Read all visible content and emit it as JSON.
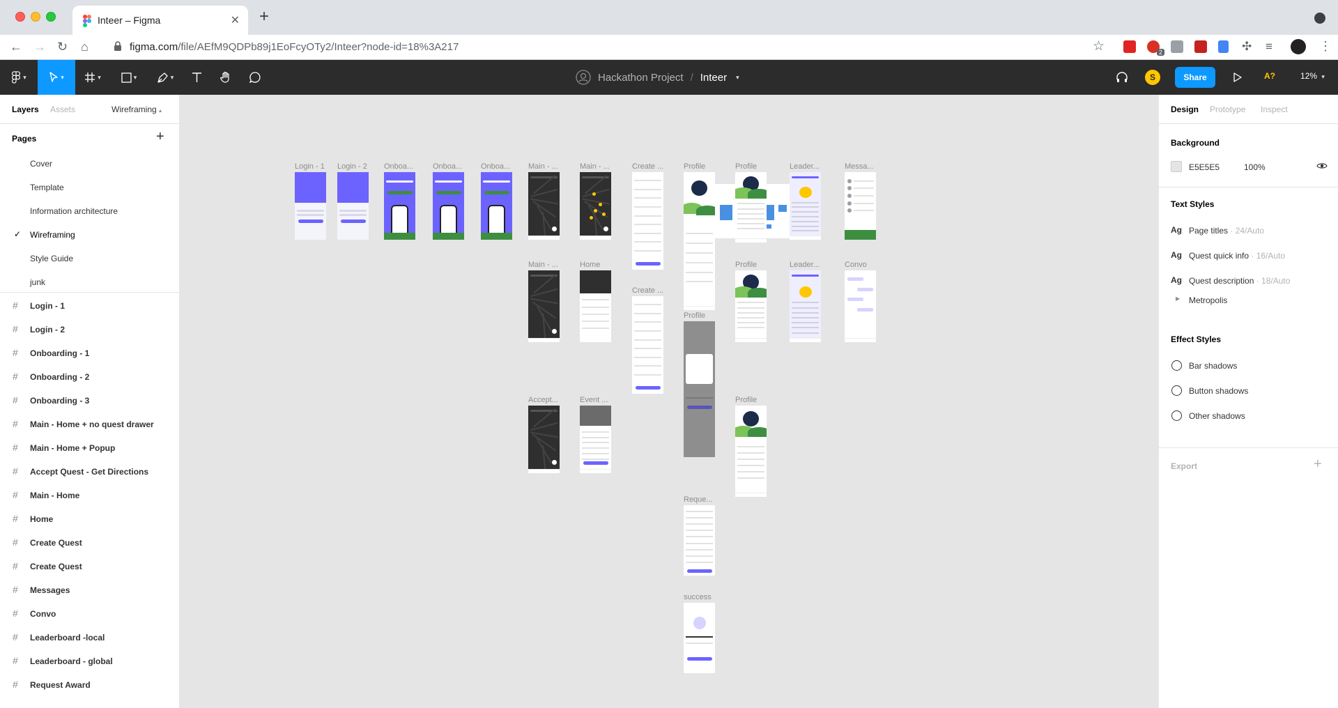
{
  "browser": {
    "tab_title": "Inteer – Figma",
    "url_host": "figma.com",
    "url_path": "/file/AEfM9QDPb89j1EoFcyOTy2/Inteer?node-id=18%3A217",
    "extension_badge": "2"
  },
  "toolbar": {
    "project": "Hackathon Project",
    "separator": "/",
    "file": "Inteer",
    "user_initial": "S",
    "share_label": "Share",
    "a_badge": "A?",
    "zoom": "12%"
  },
  "left_panel": {
    "tabs": {
      "layers": "Layers",
      "assets": "Assets",
      "current_page": "Wireframing"
    },
    "pages_title": "Pages",
    "pages": [
      {
        "label": "Cover"
      },
      {
        "label": "Template"
      },
      {
        "label": "Information architecture"
      },
      {
        "label": "Wireframing",
        "active": true
      },
      {
        "label": "Style Guide"
      },
      {
        "label": "junk"
      }
    ],
    "layers": [
      "Login - 1",
      "Login - 2",
      "Onboarding - 1",
      "Onboarding - 2",
      "Onboarding - 3",
      "Main - Home + no quest drawer",
      "Main - Home + Popup",
      "Accept Quest - Get Directions",
      "Main - Home",
      "Home",
      "Create Quest",
      "Create Quest",
      "Messages",
      "Convo",
      "Leaderboard -local",
      "Leaderboard - global",
      "Request Award"
    ]
  },
  "right_panel": {
    "tabs": {
      "design": "Design",
      "prototype": "Prototype",
      "inspect": "Inspect"
    },
    "background_title": "Background",
    "background_hex": "E5E5E5",
    "background_opacity": "100%",
    "text_styles_title": "Text Styles",
    "text_styles": [
      {
        "name": "Page titles",
        "meta": " · 24/Auto"
      },
      {
        "name": "Quest quick info",
        "meta": " · 16/Auto"
      },
      {
        "name": "Quest description",
        "meta": " · 18/Auto"
      }
    ],
    "text_style_group": "Metropolis",
    "effect_styles_title": "Effect Styles",
    "effect_styles": [
      "Bar shadows",
      "Button shadows",
      "Other shadows"
    ],
    "export_title": "Export"
  },
  "canvas": {
    "frame_labels": [
      "Login - 1",
      "Login - 2",
      "Onboa...",
      "Onboa...",
      "Onboa...",
      "Main - ...",
      "Main - ...",
      "Create ...",
      "Profile",
      "Profile",
      "Leader...",
      "Messa...",
      "Main - ...",
      "Home",
      "Create ...",
      "Profile",
      "Leader...",
      "Convo",
      "Profile",
      "Accept...",
      "Event ...",
      "Profile",
      "Reque...",
      "success"
    ]
  },
  "help_label": "?",
  "colors": {
    "accent": "#0d99ff",
    "toolbar": "#2c2c2c",
    "canvas": "#e5e5e5",
    "frame_purple": "#6c63ff"
  }
}
